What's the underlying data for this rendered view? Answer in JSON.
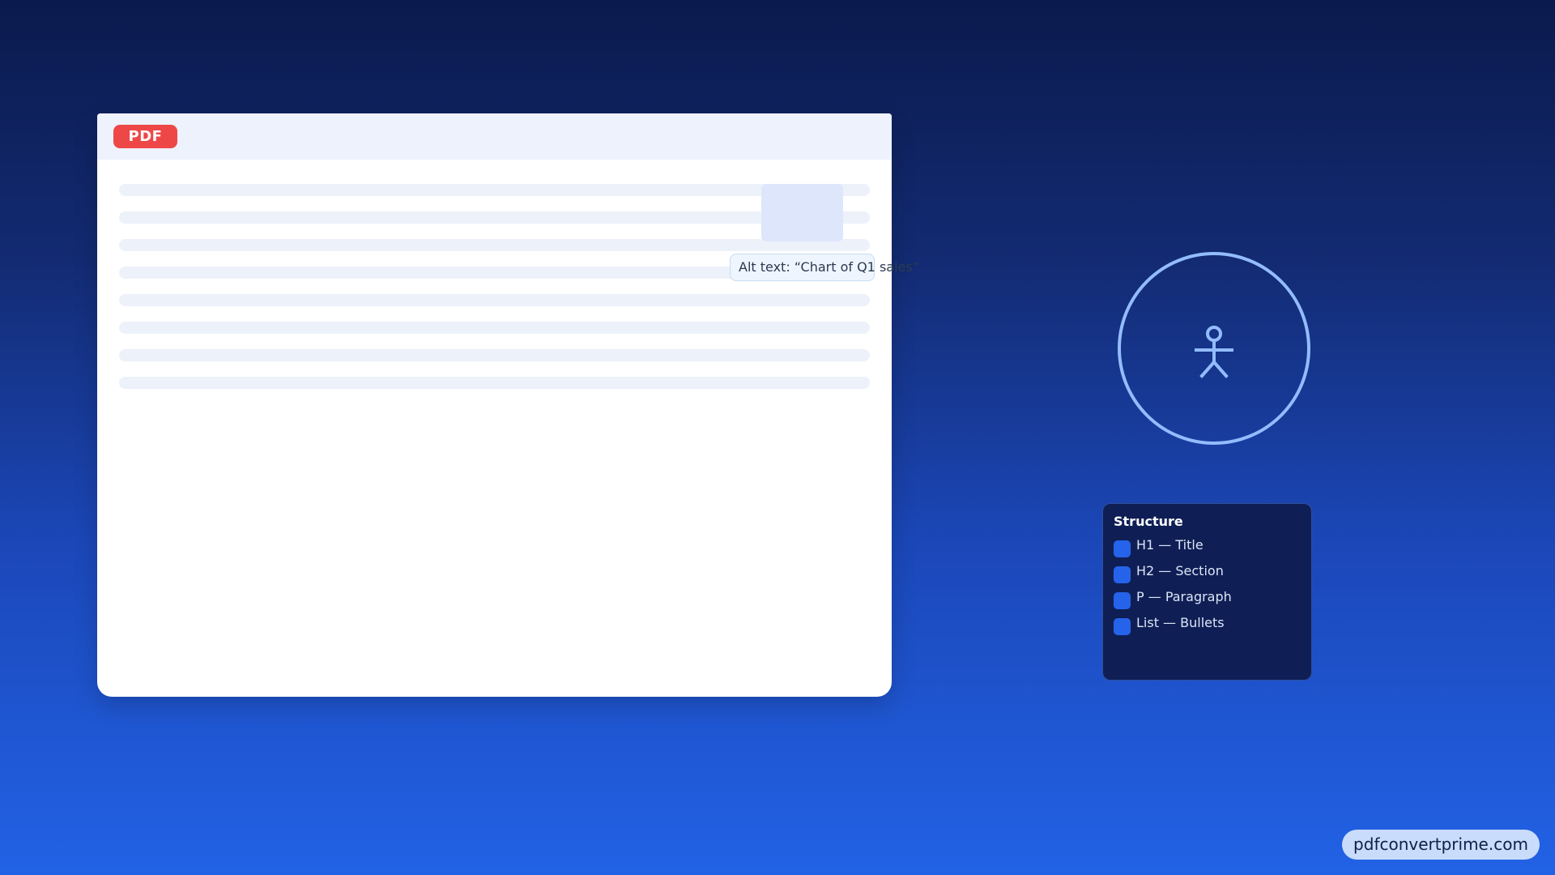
{
  "document": {
    "badge": "PDF",
    "alt_text_tooltip": "Alt text: “Chart of Q1 sales”"
  },
  "accessibility": {
    "icon": "accessibility-person-icon",
    "color": "#93bcff"
  },
  "structure_panel": {
    "title": "Structure",
    "items": [
      {
        "label": "H1 — Title"
      },
      {
        "label": "H2 — Section"
      },
      {
        "label": "P — Paragraph"
      },
      {
        "label": "List — Bullets"
      }
    ]
  },
  "footer": {
    "domain": "pdfconvertprime.com"
  },
  "colors": {
    "pdf_badge": "#ee4747",
    "structure_bg": "#0f1f55",
    "check": "#2563eb"
  }
}
